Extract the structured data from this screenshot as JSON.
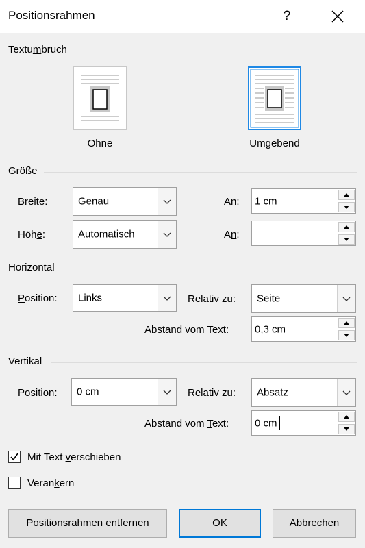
{
  "dialog": {
    "title": "Positionsrahmen",
    "help": "?",
    "close_label": "close"
  },
  "textumbruch": {
    "label_pre": "Textu",
    "label_acc": "m",
    "label_post": "bruch",
    "options": [
      {
        "label": "Ohne",
        "selected": false
      },
      {
        "label": "Umgebend",
        "selected": true
      }
    ]
  },
  "groesse": {
    "label": "Größe",
    "breite": {
      "label_pre": "",
      "label_acc": "B",
      "label_post": "reite:",
      "value": "Genau",
      "an_acc": "A",
      "an_post": "n:",
      "an_value": "1 cm"
    },
    "hoehe": {
      "label_pre": "Höh",
      "label_acc": "e",
      "label_post": ":",
      "value": "Automatisch",
      "an_pre": "A",
      "an_acc": "n",
      "an_post": ":",
      "an_value": ""
    }
  },
  "horizontal": {
    "label": "Horizontal",
    "position_pre": "",
    "position_acc": "P",
    "position_post": "osition:",
    "position_value": "Links",
    "relativ_pre": "",
    "relativ_acc": "R",
    "relativ_post": "elativ zu:",
    "relativ_value": "Seite",
    "abstand_pre": "Abstand vom Te",
    "abstand_acc": "x",
    "abstand_post": "t:",
    "abstand_value": "0,3 cm"
  },
  "vertikal": {
    "label": "Vertikal",
    "position_pre": "Pos",
    "position_acc": "i",
    "position_post": "tion:",
    "position_value": "0 cm",
    "relativ_pre": "Relativ ",
    "relativ_acc": "z",
    "relativ_post": "u:",
    "relativ_value": "Absatz",
    "abstand_pre": "Abstand vom ",
    "abstand_acc": "T",
    "abstand_post": "ext:",
    "abstand_value": "0 cm"
  },
  "checkboxes": {
    "mit_text": {
      "pre": "Mit Text ",
      "acc": "v",
      "post": "erschieben",
      "checked": true
    },
    "verankern": {
      "pre": "Veran",
      "acc": "k",
      "post": "ern",
      "checked": false
    }
  },
  "buttons": {
    "remove_pre": "Positionsrahmen ent",
    "remove_acc": "f",
    "remove_post": "ernen",
    "ok": "OK",
    "cancel": "Abbrechen"
  }
}
